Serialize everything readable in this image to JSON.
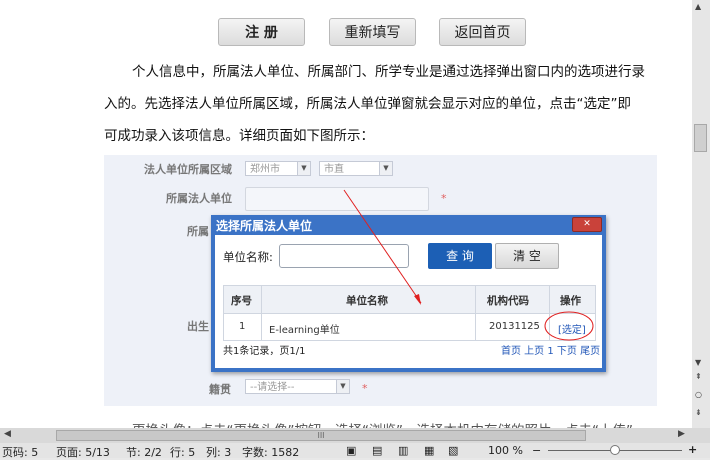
{
  "doc": {
    "buttons": {
      "register": "注 册",
      "refill": "重新填写",
      "home": "返回首页"
    },
    "para1": "个人信息中，所属法人单位、所属部门、所学专业是通过选择弹出窗口内的选项进行录",
    "para2": "入的。先选择法人单位所属区域，所属法人单位弹窗就会显示对应的单位，点击“选定”即",
    "para3": "可成功录入该项信息。详细页面如下图所示：",
    "para4_partial": "更换头像：点击“更换头像”按钮，选择“浏览”，选择本机中存储的照片，点击“上传”"
  },
  "figure": {
    "region_label": "法人单位所属区域",
    "city_value": "郑州市",
    "district_value": "市直",
    "unit_label": "所属法人单位",
    "dept_label": "所属",
    "birth_label": "出生",
    "origin_label": "籍贯",
    "origin_placeholder": "--请选择--",
    "required_mark": "*"
  },
  "dialog": {
    "title": "选择所属法人单位",
    "close": "✕",
    "name_label": "单位名称:",
    "query_button": "查 询",
    "clear_button": "清 空",
    "columns": [
      "序号",
      "单位名称",
      "机构代码",
      "操作"
    ],
    "rows": [
      {
        "no": "1",
        "name": "E-learning单位",
        "code": "20131125",
        "action": "[选定]"
      }
    ],
    "summary": "共1条记录，页1/1",
    "pager": "首页 上页 1 下页 尾页"
  },
  "statusbar": {
    "page_no": "页码: 5",
    "pages": "页面: 5/13",
    "section": "节: 2/2",
    "row": "行: 5",
    "col": "列: 3",
    "chars": "字数: 1582",
    "zoom": "100 %"
  },
  "colors": {
    "dialog_blue": "#3b73c6",
    "query_blue": "#1c5fb5",
    "annotation_red": "#e02020"
  }
}
